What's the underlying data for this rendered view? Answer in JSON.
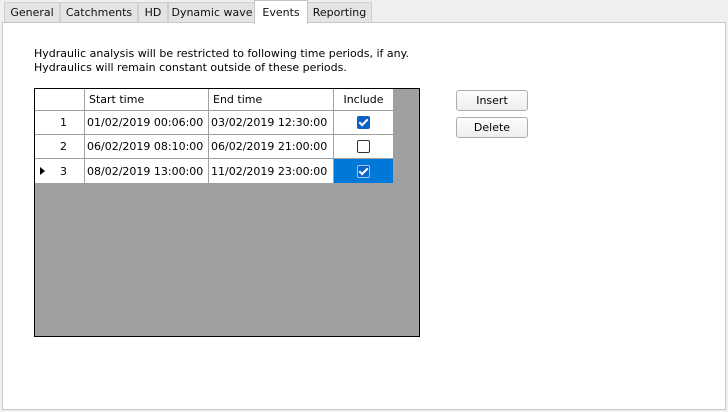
{
  "tabs": [
    {
      "label": "General"
    },
    {
      "label": "Catchments"
    },
    {
      "label": "HD"
    },
    {
      "label": "Dynamic wave"
    },
    {
      "label": "Events",
      "active": true
    },
    {
      "label": "Reporting"
    }
  ],
  "description": {
    "line1": "Hydraulic analysis will be restricted to following time periods, if any.",
    "line2": "Hydraulics will remain constant outside of these periods."
  },
  "grid": {
    "columns": [
      "",
      "Start time",
      "End time",
      "Include"
    ],
    "rows": [
      {
        "num": "1",
        "start": "01/02/2019 00:06:00",
        "end": "03/02/2019 12:30:00",
        "include": true
      },
      {
        "num": "2",
        "start": "06/02/2019 08:10:00",
        "end": "06/02/2019 21:00:00",
        "include": false
      },
      {
        "num": "3",
        "start": "08/02/2019 13:00:00",
        "end": "11/02/2019 23:00:00",
        "include": true,
        "current": true
      }
    ]
  },
  "buttons": {
    "insert": "Insert",
    "delete": "Delete"
  },
  "colors": {
    "selection": "#0078d7",
    "grid_background": "#a0a0a0"
  }
}
